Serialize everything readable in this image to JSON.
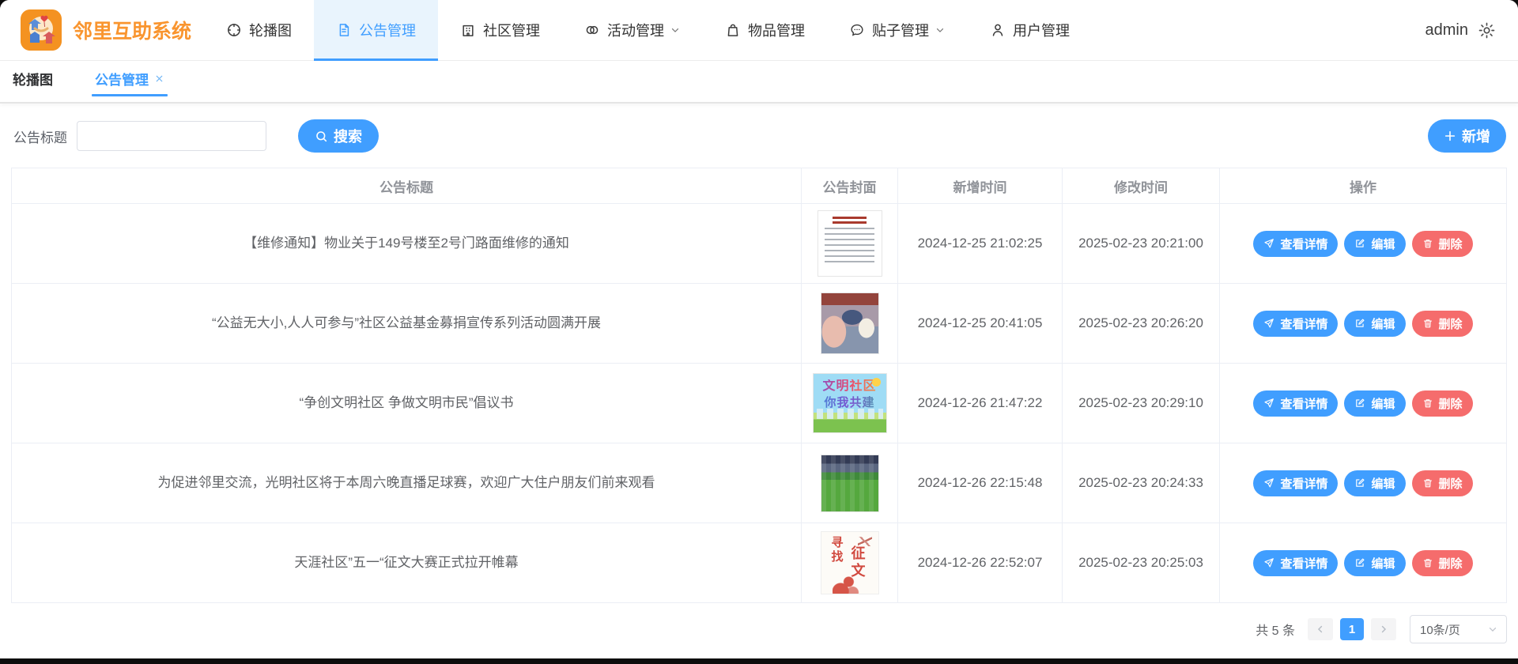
{
  "app": {
    "title": "邻里互助系统",
    "user": "admin"
  },
  "nav": {
    "items": [
      {
        "id": "carousel",
        "label": "轮播图",
        "icon": "carousel-icon",
        "active": false,
        "dropdown": false
      },
      {
        "id": "announcement",
        "label": "公告管理",
        "icon": "announcement-icon",
        "active": true,
        "dropdown": false
      },
      {
        "id": "community",
        "label": "社区管理",
        "icon": "community-icon",
        "active": false,
        "dropdown": false
      },
      {
        "id": "activity",
        "label": "活动管理",
        "icon": "activity-icon",
        "active": false,
        "dropdown": true
      },
      {
        "id": "goods",
        "label": "物品管理",
        "icon": "goods-icon",
        "active": false,
        "dropdown": false
      },
      {
        "id": "posts",
        "label": "贴子管理",
        "icon": "posts-icon",
        "active": false,
        "dropdown": true
      },
      {
        "id": "users",
        "label": "用户管理",
        "icon": "user-icon",
        "active": false,
        "dropdown": false
      }
    ]
  },
  "tabs": [
    {
      "id": "carousel",
      "label": "轮播图",
      "active": false,
      "closable": false
    },
    {
      "id": "announcement",
      "label": "公告管理",
      "active": true,
      "closable": true
    }
  ],
  "filter": {
    "label": "公告标题",
    "value": "",
    "search_label": "搜索",
    "add_label": "新增"
  },
  "table": {
    "columns": [
      "公告标题",
      "公告封面",
      "新增时间",
      "修改时间",
      "操作"
    ],
    "actions": [
      {
        "id": "view",
        "label": "查看详情",
        "icon": "send-icon",
        "type": "primary"
      },
      {
        "id": "edit",
        "label": "编辑",
        "icon": "edit-icon",
        "type": "primary"
      },
      {
        "id": "delete",
        "label": "删除",
        "icon": "trash-icon",
        "type": "danger"
      }
    ],
    "rows": [
      {
        "title": "【维修通知】物业关于149号楼至2号门路面维修的通知",
        "cover": {
          "kind": "notice-document"
        },
        "created": "2024-12-25 21:02:25",
        "modified": "2025-02-23 20:21:00"
      },
      {
        "title": "“公益无大小,人人可参与”社区公益基金募捐宣传系列活动圆满开展",
        "cover": {
          "kind": "charity-event-photo"
        },
        "created": "2024-12-25 20:41:05",
        "modified": "2025-02-23 20:26:20"
      },
      {
        "title": "“争创文明社区 争做文明市民”倡议书",
        "cover": {
          "kind": "civility-poster",
          "text1": "文明社区",
          "text2": "你我共建"
        },
        "created": "2024-12-26 21:47:22",
        "modified": "2025-02-23 20:29:10"
      },
      {
        "title": "为促进邻里交流，光明社区将于本周六晚直播足球赛，欢迎广大住户朋友们前来观看",
        "cover": {
          "kind": "football-match-photo"
        },
        "created": "2024-12-26 22:15:48",
        "modified": "2025-02-23 20:24:33"
      },
      {
        "title": "天涯社区”五一“征文大赛正式拉开帷幕",
        "cover": {
          "kind": "essay-contest-poster",
          "text1": "寻找",
          "text2": "征文"
        },
        "created": "2024-12-26 22:52:07",
        "modified": "2025-02-23 20:25:03"
      }
    ]
  },
  "pagination": {
    "total": "共 5 条",
    "page": "1",
    "page_size": "10条/页"
  },
  "colors": {
    "accent": "#409eff",
    "danger": "#f56c6c",
    "brand": "#f9952f",
    "nav_active_bg": "#e9f4fd",
    "header_text": "#909399",
    "body_text": "#606266",
    "border": "#ebeef5"
  }
}
